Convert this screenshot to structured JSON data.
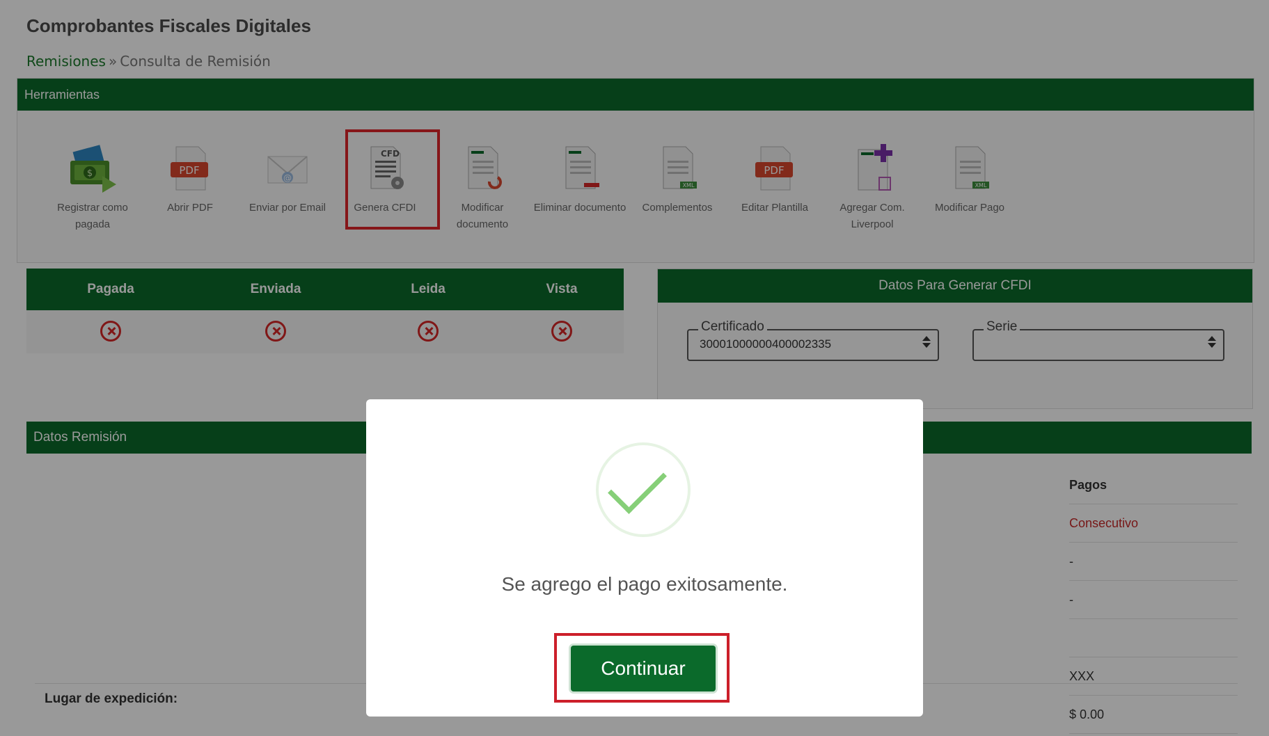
{
  "page": {
    "title": "Comprobantes Fiscales Digitales",
    "breadcrumb": {
      "link": "Remisiones",
      "separator": "»",
      "current": "Consulta de Remisión"
    }
  },
  "tools": {
    "header": "Herramientas",
    "items": [
      {
        "label": "Registrar como pagada",
        "icon": "money-stack-icon"
      },
      {
        "label": "Abrir PDF",
        "icon": "pdf-icon"
      },
      {
        "label": "Enviar por Email",
        "icon": "email-icon"
      },
      {
        "label": "Genera CFDI",
        "icon": "cfd-document-icon",
        "badge": "CFD"
      },
      {
        "label": "Modificar documento",
        "icon": "edit-document-icon"
      },
      {
        "label": "Eliminar documento",
        "icon": "delete-document-icon"
      },
      {
        "label": "Complementos",
        "icon": "xml-document-icon",
        "badge": "XML"
      },
      {
        "label": "Editar Plantilla",
        "icon": "pdf-icon"
      },
      {
        "label": "Agregar Com. Liverpool",
        "icon": "add-document-icon"
      },
      {
        "label": "Modificar Pago",
        "icon": "xml-document-icon",
        "badge": "XML"
      }
    ],
    "pdf_badge": "PDF"
  },
  "status": {
    "headers": [
      "Pagada",
      "Enviada",
      "Leida",
      "Vista"
    ],
    "values": [
      "no",
      "no",
      "no",
      "no"
    ]
  },
  "cfdi": {
    "header": "Datos Para Generar CFDI",
    "certificado": {
      "label": "Certificado",
      "value": "30001000000400002335"
    },
    "serie": {
      "label": "Serie",
      "value": ""
    }
  },
  "remision": {
    "header": "Datos Remisión",
    "pagos_header": "Pagos",
    "pagos_values": [
      "Consecutivo",
      "-",
      "-",
      "",
      "XXX",
      "$ 0.00"
    ],
    "lugar_label": "Lugar de expedición:"
  },
  "modal": {
    "message": "Se agrego el pago exitosamente.",
    "button": "Continuar"
  },
  "colors": {
    "brand_green": "#0b6a2b",
    "highlight_red": "#e0262b",
    "success_green": "#86cf78",
    "status_red": "#d62727"
  }
}
